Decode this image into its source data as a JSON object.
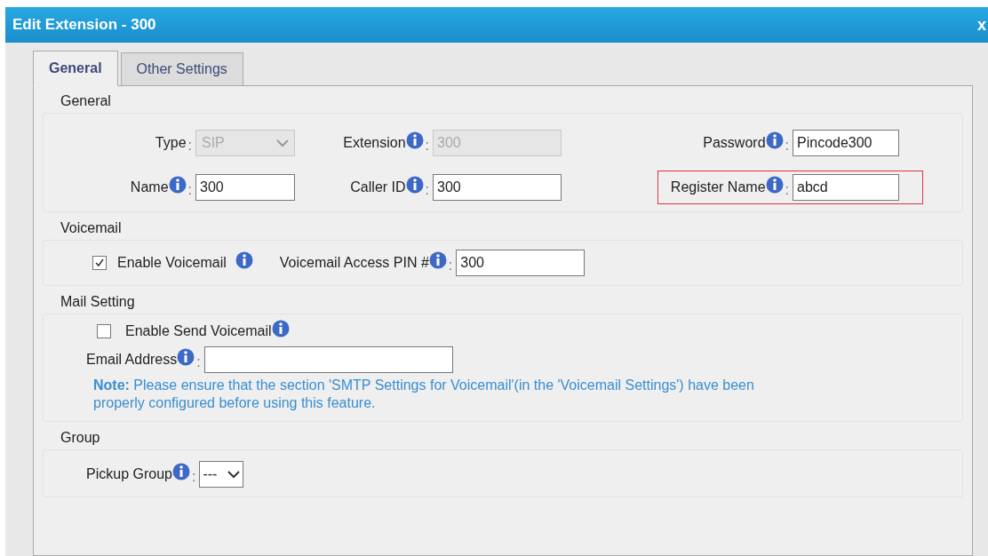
{
  "window": {
    "title": "Edit Extension - 300",
    "close": "x"
  },
  "tabs": [
    {
      "label": "General",
      "selected": true
    },
    {
      "label": "Other Settings",
      "selected": false
    }
  ],
  "general": {
    "legend": "General",
    "fields": [
      {
        "label": "Type",
        "colon": ":",
        "kind": "select",
        "value": "SIP",
        "disabled": true,
        "info": false,
        "highlighted": false
      },
      {
        "label": "Extension",
        "colon": ":",
        "kind": "input",
        "value": "300",
        "disabled": true,
        "info": true,
        "highlighted": false
      },
      {
        "label": "Password",
        "colon": ":",
        "kind": "input",
        "value": "Pincode300",
        "disabled": false,
        "info": true,
        "highlighted": false
      },
      {
        "label": "Name",
        "colon": ":",
        "kind": "input",
        "value": "300",
        "disabled": false,
        "info": true,
        "highlighted": false
      },
      {
        "label": "Caller ID",
        "colon": ":",
        "kind": "input",
        "value": "300",
        "disabled": false,
        "info": true,
        "highlighted": false
      },
      {
        "label": "Register Name",
        "colon": ":",
        "kind": "input",
        "value": "abcd",
        "disabled": false,
        "info": true,
        "highlighted": true
      }
    ]
  },
  "voicemail": {
    "legend": "Voicemail",
    "enable": {
      "label": "Enable Voicemail",
      "checked": true
    },
    "pin": {
      "label": "Voicemail Access PIN #",
      "colon": ":",
      "value": "300"
    }
  },
  "mail": {
    "legend": "Mail Setting",
    "enable": {
      "label": "Enable Send Voicemail",
      "checked": false
    },
    "email": {
      "label": "Email Address",
      "colon": ":"
    },
    "note": "**Note:** Please ensure that the section 'SMTP Settings for Voicemail'(in the 'Voicemail Settings') have been properly configured before using this feature."
  },
  "group": {
    "legend": "Group",
    "pickup": {
      "label": "Pickup Group",
      "colon": ":",
      "value": "---"
    }
  }
}
